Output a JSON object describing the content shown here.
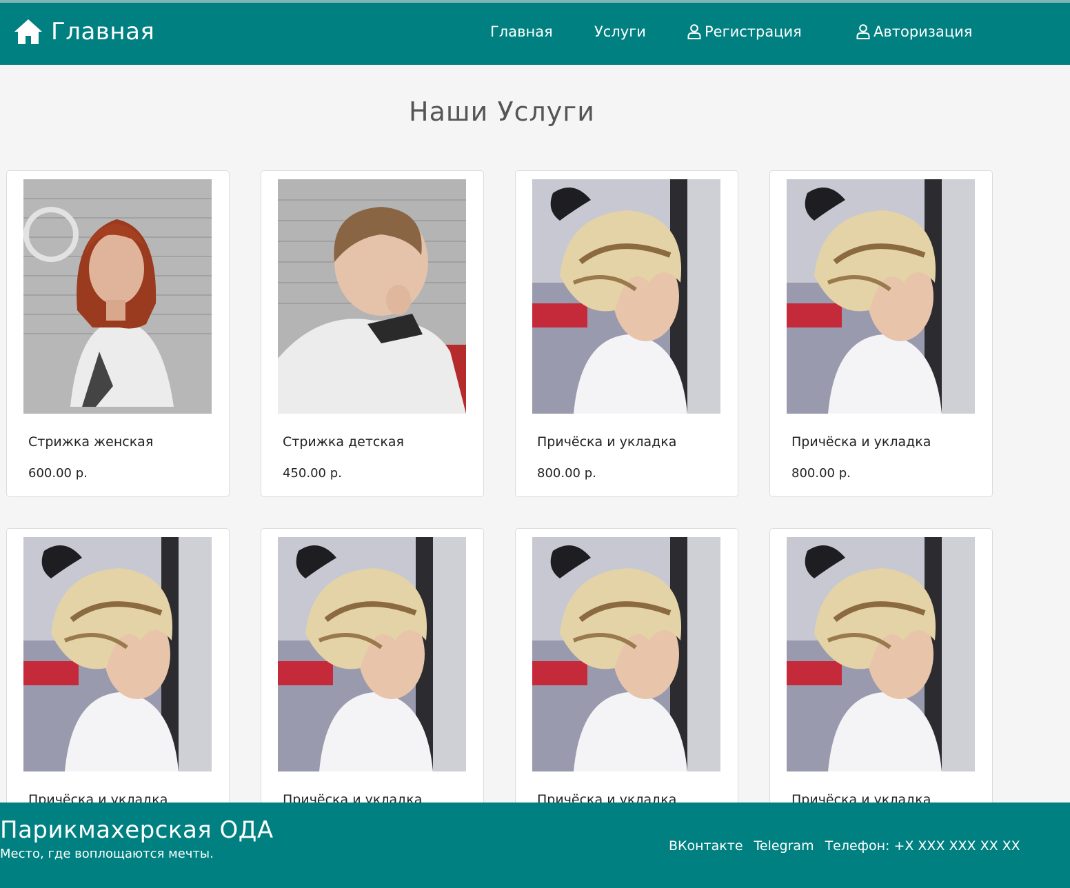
{
  "nav": {
    "brand": "Главная",
    "links": [
      {
        "label": "Главная",
        "icon": null
      },
      {
        "label": "Услуги",
        "icon": null
      },
      {
        "label": "Регистрация",
        "icon": "user-icon"
      },
      {
        "label": "Авторизация",
        "icon": "user-icon"
      }
    ]
  },
  "main": {
    "title": "Наши Услуги",
    "services": [
      {
        "name": "Стрижка женская",
        "price": "600.00 р.",
        "photo": "woman-red-haircut-photo"
      },
      {
        "name": "Стрижка детская",
        "price": "450.00 р.",
        "photo": "child-haircut-photo"
      },
      {
        "name": "Причёска и укладка",
        "price": "800.00 р.",
        "photo": "blonde-updo-photo"
      },
      {
        "name": "Причёска и укладка",
        "price": "800.00 р.",
        "photo": "blonde-updo-photo"
      },
      {
        "name": "Причёска и укладка",
        "price": "",
        "photo": "blonde-updo-photo"
      },
      {
        "name": "Причёска и укладка",
        "price": "",
        "photo": "blonde-updo-photo"
      },
      {
        "name": "Причёска и укладка",
        "price": "",
        "photo": "blonde-updo-photo"
      },
      {
        "name": "Причёска и укладка",
        "price": "",
        "photo": "blonde-updo-photo"
      }
    ]
  },
  "footer": {
    "title": "Парикмахерская ОДА",
    "tagline": "Место, где воплощаются мечты.",
    "vk": "ВКонтакте",
    "telegram": "Telegram",
    "phone": "Телефон: +X XXX XXX XX XX"
  },
  "colors": {
    "primary": "#008080",
    "background": "#f5f5f5",
    "card": "#ffffff"
  }
}
